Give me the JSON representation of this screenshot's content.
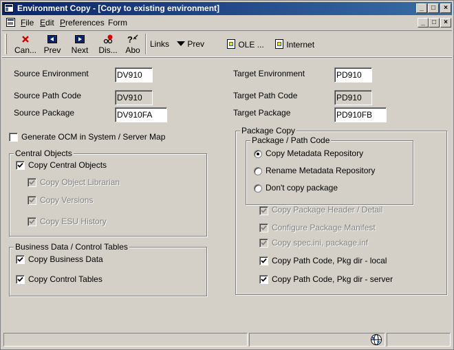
{
  "window": {
    "title": "Environment Copy - [Copy to existing environment]",
    "controls": {
      "minimize": "_",
      "maximize": "□",
      "close": "×"
    }
  },
  "menubar": {
    "items": [
      {
        "label": "File",
        "accel": "F",
        "rest": "ile"
      },
      {
        "label": "Edit",
        "accel": "E",
        "rest": "dit"
      },
      {
        "label": "Preferences",
        "accel": "P",
        "rest": "references"
      },
      {
        "label": "Form",
        "accel": "",
        "rest": "Form"
      }
    ]
  },
  "toolbar": {
    "buttons": [
      {
        "label": "Can...",
        "icon": "cancel-x-icon"
      },
      {
        "label": "Prev",
        "icon": "prev-icon"
      },
      {
        "label": "Next",
        "icon": "next-icon"
      },
      {
        "label": "Dis...",
        "icon": "display-icon"
      },
      {
        "label": "Abo",
        "icon": "about-icon"
      }
    ],
    "links_label": "Links",
    "prev_label": "Prev",
    "ole_label": "OLE ...",
    "internet_label": "Internet"
  },
  "source": {
    "env_label": "Source Environment",
    "env_value": "DV910",
    "path_label": "Source Path Code",
    "path_value": "DV910",
    "pkg_label": "Source Package",
    "pkg_value": "DV910FA"
  },
  "target": {
    "env_label": "Target Environment",
    "env_value": "PD910",
    "path_label": "Target Path Code",
    "path_value": "PD910",
    "pkg_label": "Target Package",
    "pkg_value": "PD910FB"
  },
  "generate_ocm": {
    "label": "Generate OCM in System / Server Map",
    "checked": false
  },
  "central_objects": {
    "title": "Central Objects",
    "copy_central": "Copy Central Objects",
    "copy_librarian": "Copy Object Librarian",
    "copy_versions": "Copy Versions",
    "copy_esu": "Copy ESU History"
  },
  "business_data": {
    "title": "Business Data / Control Tables",
    "copy_business": "Copy Business Data",
    "copy_control": "Copy Control Tables"
  },
  "package_copy": {
    "title": "Package Copy",
    "path_title": "Package / Path Code",
    "radio_copy": "Copy Metadata Repository",
    "radio_rename": "Rename Metadata Repository",
    "radio_dont": "Don't copy package",
    "selected": "Copy Metadata Repository",
    "pkg_header": "Copy Package Header / Detail",
    "pkg_manifest": "Configure Package Manifest",
    "spec_ini": "Copy spec.ini, package.inf",
    "path_local": "Copy Path Code, Pkg dir - local",
    "path_server": "Copy Path Code, Pkg dir - server"
  }
}
